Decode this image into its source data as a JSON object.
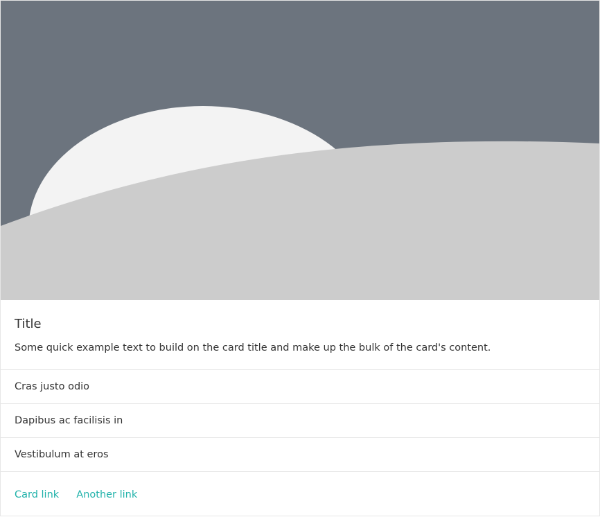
{
  "card": {
    "image": {
      "colors": {
        "sky": "#6c747e",
        "sun": "#f3f3f3",
        "hill": "#cccccc"
      }
    },
    "title": "Title",
    "text": "Some quick example text to build on the card title and make up the bulk of the card's content.",
    "list": [
      {
        "label": "Cras justo odio"
      },
      {
        "label": "Dapibus ac facilisis in"
      },
      {
        "label": "Vestibulum at eros"
      }
    ],
    "links": [
      {
        "label": "Card link"
      },
      {
        "label": "Another link"
      }
    ],
    "colors": {
      "link": "#20b2aa",
      "border": "#e6e6e6",
      "text": "#333333"
    }
  }
}
